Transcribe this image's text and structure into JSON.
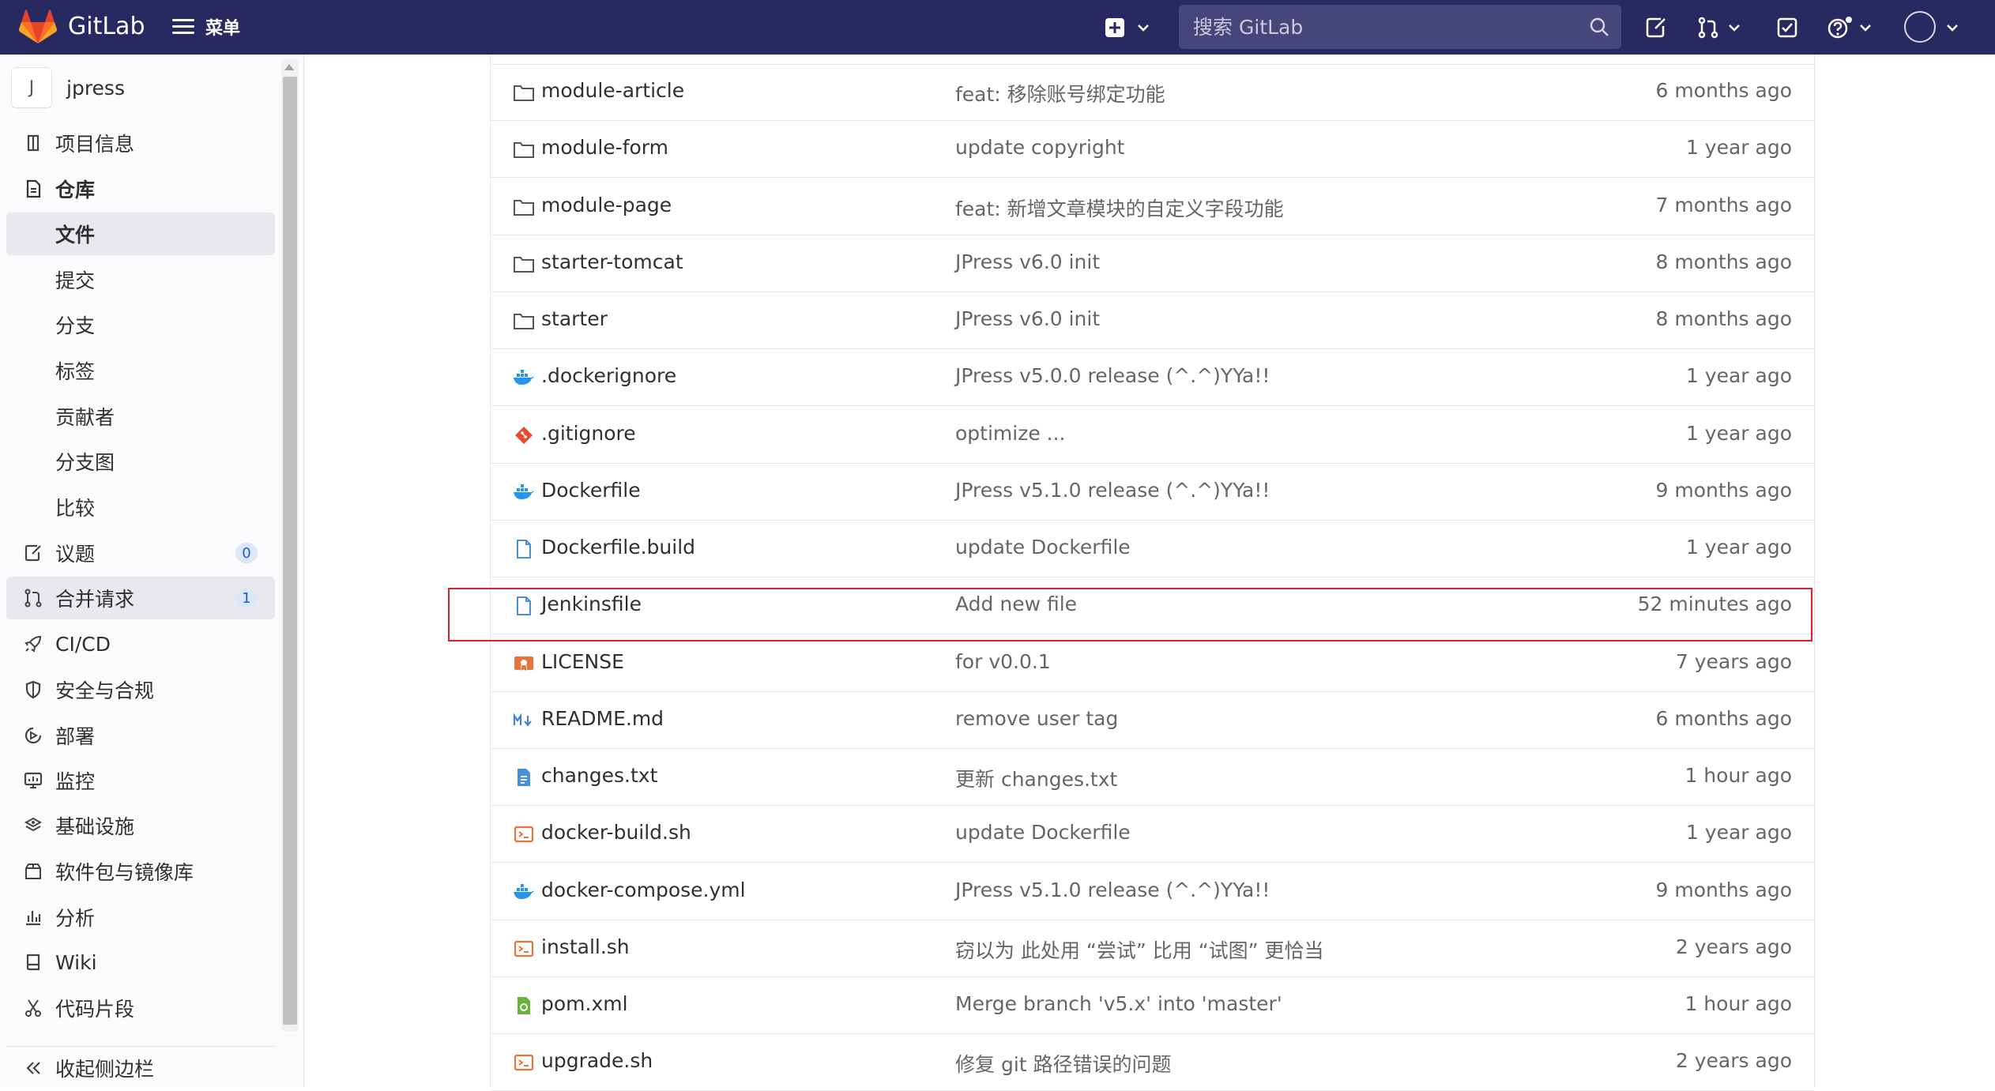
{
  "navbar": {
    "brand": "GitLab",
    "menu_label": "菜单",
    "search_placeholder": "搜索 GitLab"
  },
  "sidebar": {
    "project_initial": "J",
    "project_name": "jpress",
    "items": [
      {
        "label": "项目信息",
        "icon": "info-icon"
      },
      {
        "label": "仓库",
        "icon": "repository-icon"
      },
      {
        "label": "文件"
      },
      {
        "label": "提交"
      },
      {
        "label": "分支"
      },
      {
        "label": "标签"
      },
      {
        "label": "贡献者"
      },
      {
        "label": "分支图"
      },
      {
        "label": "比较"
      },
      {
        "label": "议题",
        "icon": "issues-icon",
        "badge": "0"
      },
      {
        "label": "合并请求",
        "icon": "merge-request-icon",
        "badge": "1"
      },
      {
        "label": "CI/CD",
        "icon": "rocket-icon"
      },
      {
        "label": "安全与合规",
        "icon": "shield-icon"
      },
      {
        "label": "部署",
        "icon": "deploy-icon"
      },
      {
        "label": "监控",
        "icon": "monitor-icon"
      },
      {
        "label": "基础设施",
        "icon": "infrastructure-icon"
      },
      {
        "label": "软件包与镜像库",
        "icon": "package-icon"
      },
      {
        "label": "分析",
        "icon": "analytics-icon"
      },
      {
        "label": "Wiki",
        "icon": "book-icon"
      },
      {
        "label": "代码片段",
        "icon": "scissors-icon"
      }
    ],
    "collapse_label": "收起侧边栏"
  },
  "files": [
    {
      "name": "module-article",
      "type": "folder",
      "message": "feat: 移除账号绑定功能",
      "time": "6 months ago"
    },
    {
      "name": "module-form",
      "type": "folder",
      "message": "update copyright",
      "time": "1 year ago"
    },
    {
      "name": "module-page",
      "type": "folder",
      "message": "feat: 新增文章模块的自定义字段功能",
      "time": "7 months ago"
    },
    {
      "name": "starter-tomcat",
      "type": "folder",
      "message": "JPress v6.0 init",
      "time": "8 months ago"
    },
    {
      "name": "starter",
      "type": "folder",
      "message": "JPress v6.0 init",
      "time": "8 months ago"
    },
    {
      "name": ".dockerignore",
      "type": "docker",
      "message": "JPress v5.0.0 release (^.^)YYa!!",
      "time": "1 year ago"
    },
    {
      "name": ".gitignore",
      "type": "git",
      "message": "optimize ...",
      "time": "1 year ago"
    },
    {
      "name": "Dockerfile",
      "type": "docker",
      "message": "JPress v5.1.0 release (^.^)YYa!!",
      "time": "9 months ago"
    },
    {
      "name": "Dockerfile.build",
      "type": "file",
      "message": "update Dockerfile",
      "time": "1 year ago"
    },
    {
      "name": "Jenkinsfile",
      "type": "file",
      "message": "Add new file",
      "time": "52 minutes ago"
    },
    {
      "name": "LICENSE",
      "type": "license",
      "message": "for v0.0.1",
      "time": "7 years ago"
    },
    {
      "name": "README.md",
      "type": "markdown",
      "message": "remove user tag",
      "time": "6 months ago"
    },
    {
      "name": "changes.txt",
      "type": "text",
      "message": "更新 changes.txt",
      "time": "1 hour ago"
    },
    {
      "name": "docker-build.sh",
      "type": "shell",
      "message": "update Dockerfile",
      "time": "1 year ago"
    },
    {
      "name": "docker-compose.yml",
      "type": "docker",
      "message": "JPress v5.1.0 release (^.^)YYa!!",
      "time": "9 months ago"
    },
    {
      "name": "install.sh",
      "type": "shell",
      "message": "窃以为 此处用 “尝试” 比用 “试图” 更恰当",
      "time": "2 years ago"
    },
    {
      "name": "pom.xml",
      "type": "maven",
      "message": "Merge branch 'v5.x' into 'master'",
      "time": "1 hour ago"
    },
    {
      "name": "upgrade.sh",
      "type": "shell",
      "message": "修复 git 路径错误的问题",
      "time": "2 years ago"
    }
  ],
  "highlighted_file": "Jenkinsfile",
  "colors": {
    "navbar": "#292961",
    "highlight_border": "#e0202a",
    "docker": "#2496ed",
    "git": "#e44c30",
    "shell": "#e8743b",
    "maven": "#6cb33e",
    "file": "#4a90d9"
  }
}
